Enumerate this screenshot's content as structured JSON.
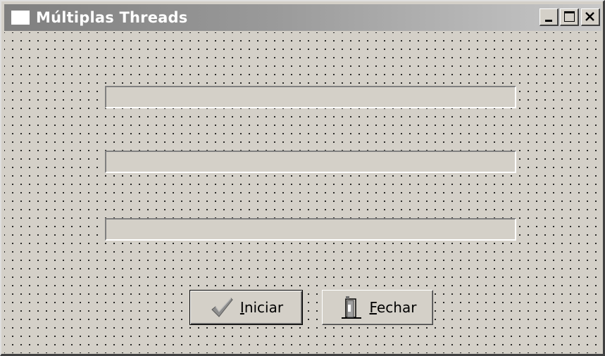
{
  "window": {
    "title": "Múltiplas Threads",
    "controls": {
      "minimize_icon": "minimize-icon",
      "maximize_icon": "maximize-icon",
      "close_icon": "close-icon"
    }
  },
  "progress_bars": [
    {
      "value": 0
    },
    {
      "value": 0
    },
    {
      "value": 0
    }
  ],
  "buttons": {
    "iniciar": {
      "mnemonic": "I",
      "rest": "niciar",
      "icon": "checkmark-icon"
    },
    "fechar": {
      "mnemonic": "F",
      "rest": "echar",
      "icon": "door-exit-icon"
    }
  },
  "colors": {
    "face": "#d4d0c8",
    "title_gradient_start": "#7f7f7f",
    "title_gradient_end": "#c8c8c8",
    "progress_fill": "#0a246a"
  }
}
